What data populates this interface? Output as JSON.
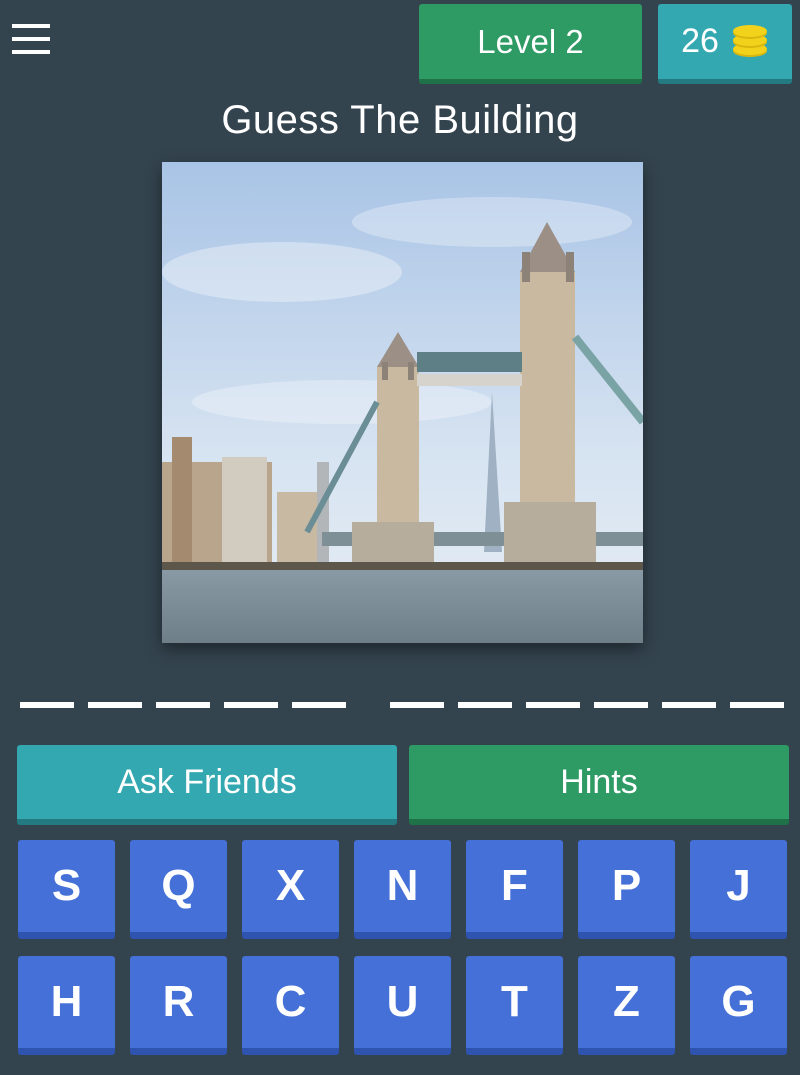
{
  "header": {
    "level_label": "Level 2",
    "coins": "26"
  },
  "title": "Guess The Building",
  "answer": {
    "word_lengths": [
      5,
      6
    ]
  },
  "buttons": {
    "ask_friends": "Ask Friends",
    "hints": "Hints"
  },
  "keyboard": {
    "row1": [
      "S",
      "Q",
      "X",
      "N",
      "F",
      "P",
      "J"
    ],
    "row2": [
      "H",
      "R",
      "C",
      "U",
      "T",
      "Z",
      "G"
    ]
  },
  "colors": {
    "background": "#34444f",
    "green": "#2e9a64",
    "teal": "#33a8b0",
    "key_blue": "#4470d8",
    "coin_yellow": "#f2d21b"
  }
}
